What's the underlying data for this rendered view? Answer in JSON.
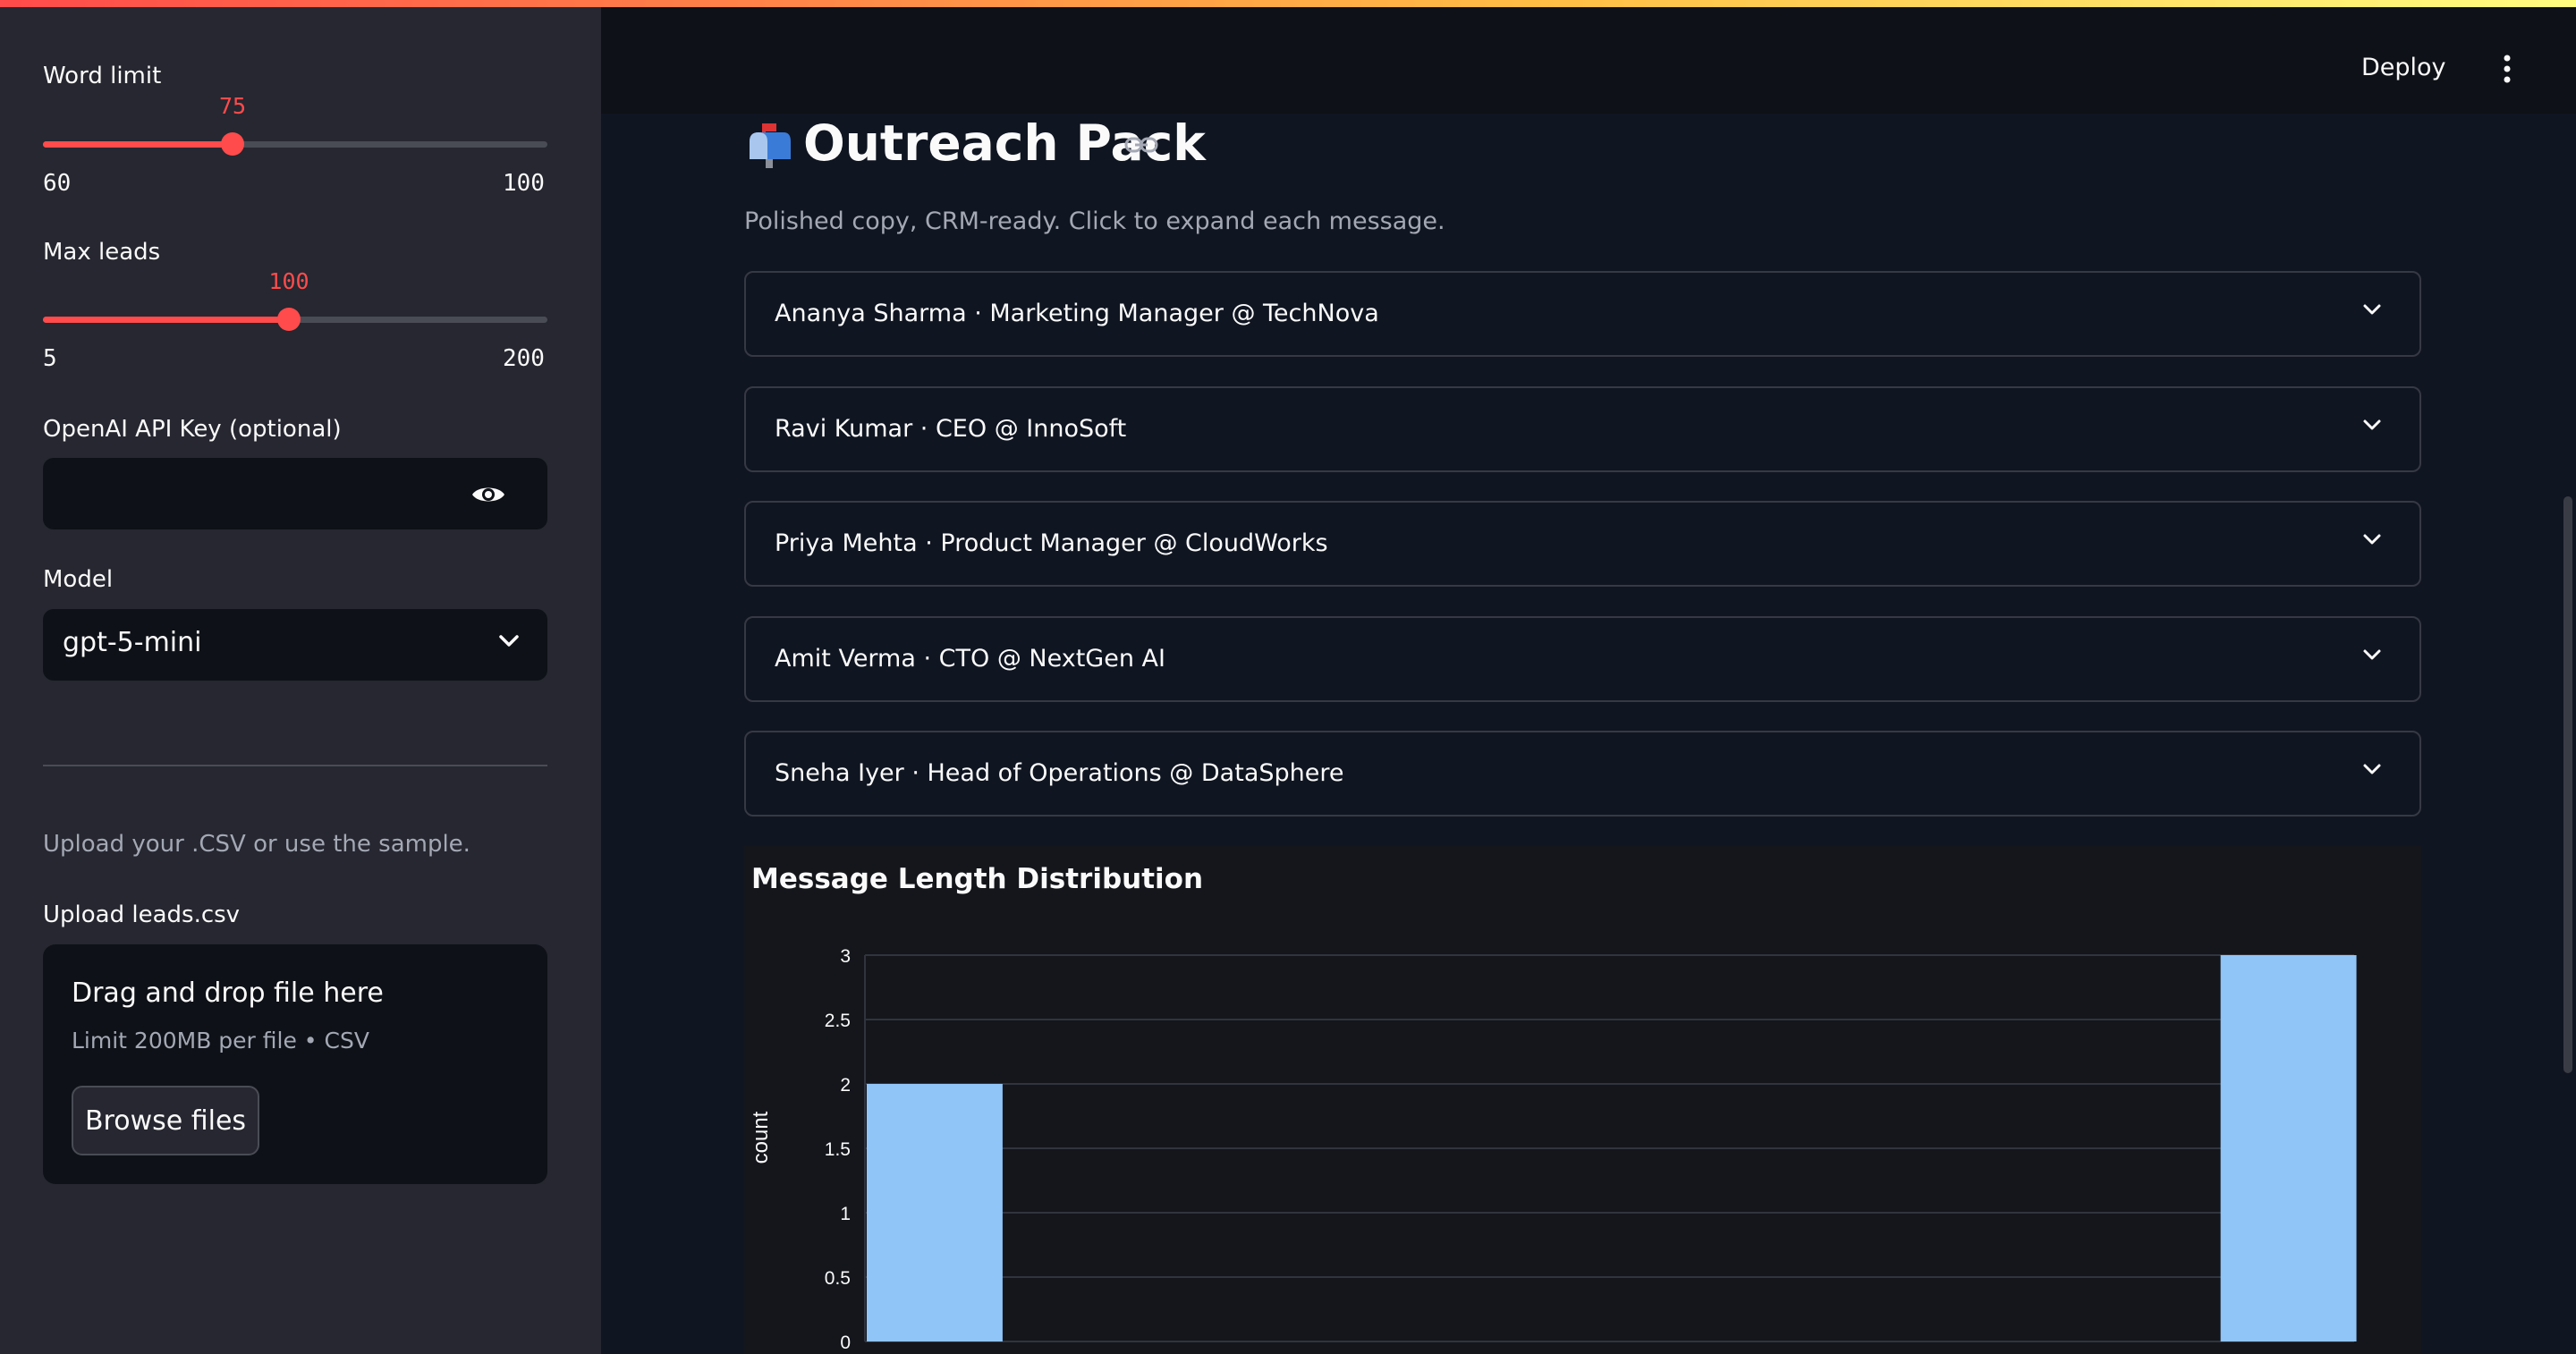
{
  "sidebar": {
    "word_limit": {
      "label": "Word limit",
      "value": "75",
      "min": "60",
      "max": "100"
    },
    "max_leads": {
      "label": "Max leads",
      "value": "100",
      "min": "5",
      "max": "200"
    },
    "api_key": {
      "label": "OpenAI API Key (optional)",
      "value": ""
    },
    "model": {
      "label": "Model",
      "value": "gpt-5-mini"
    },
    "caption": "Upload your .CSV or use the sample.",
    "upload": {
      "label": "Upload leads.csv",
      "drop_title": "Drag and drop file here",
      "drop_sub": "Limit 200MB per file • CSV",
      "browse_label": "Browse files"
    }
  },
  "header": {
    "deploy_label": "Deploy"
  },
  "main": {
    "title_icon": "mailbox-icon",
    "title": "Outreach Pack",
    "subtitle": "Polished copy, CRM-ready. Click to expand each message.",
    "messages": [
      {
        "label": "Ananya Sharma · Marketing Manager @ TechNova"
      },
      {
        "label": "Ravi Kumar · CEO @ InnoSoft"
      },
      {
        "label": "Priya Mehta · Product Manager @ CloudWorks"
      },
      {
        "label": "Amit Verma · CTO @ NextGen AI"
      },
      {
        "label": "Sneha Iyer · Head of Operations @ DataSphere"
      }
    ]
  },
  "colors": {
    "accent": "#ff4b4b",
    "bar": "#90c5f8",
    "sidebar_bg": "#262730",
    "main_bg": "#0e1117"
  },
  "chart_data": {
    "type": "bar",
    "title": "Message Length Distribution",
    "ylabel": "count",
    "xlabel": "",
    "ylim": [
      0,
      3
    ],
    "yticks": [
      "0",
      "0.5",
      "1",
      "1.5",
      "2",
      "2.5",
      "3"
    ],
    "bins": [
      {
        "index": 0,
        "value": 2
      },
      {
        "index": 10,
        "value": 3
      }
    ],
    "bin_count": 11,
    "grid": true
  }
}
